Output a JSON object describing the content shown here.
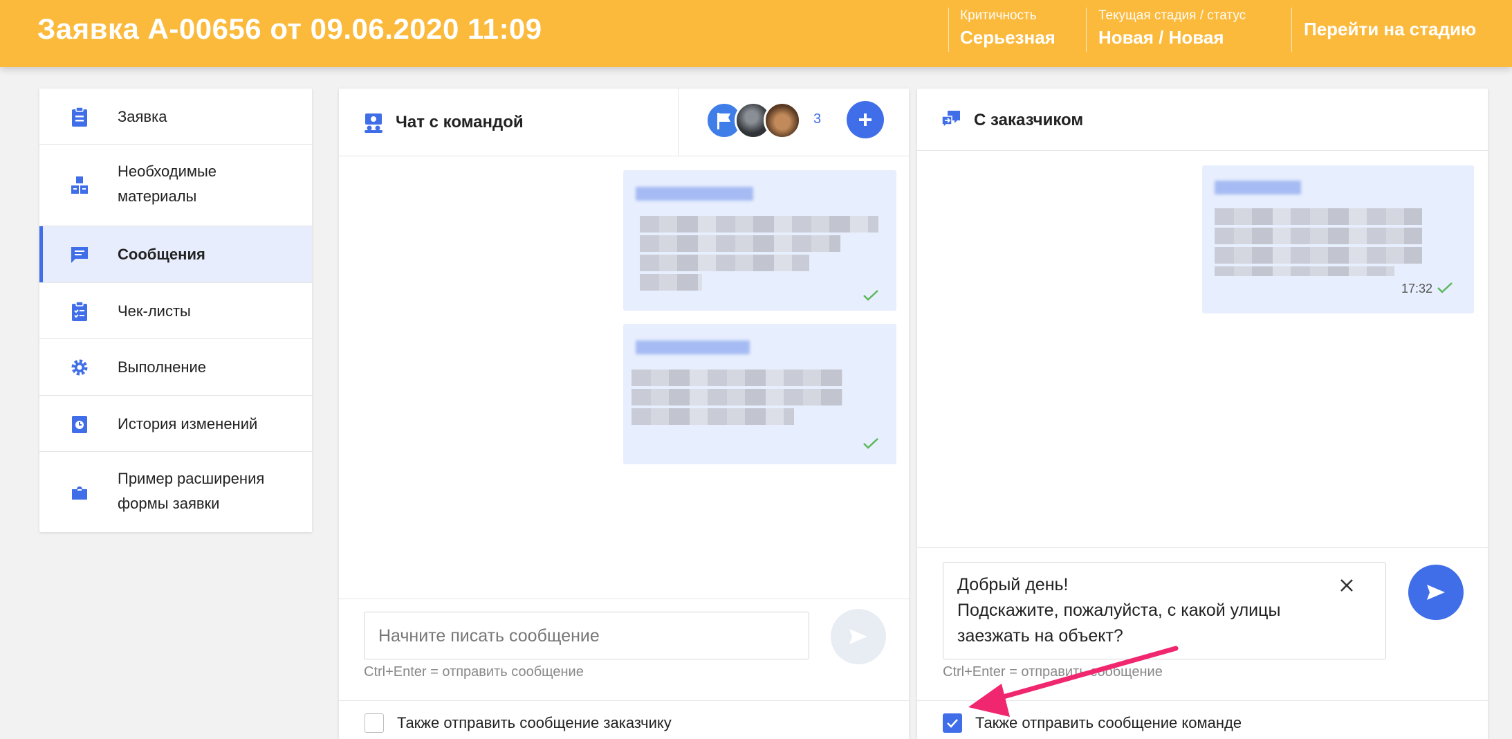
{
  "header": {
    "title": "Заявка А-00656 от 09.06.2020 11:09",
    "criticality_label": "Критичность",
    "criticality_value": "Серьезная",
    "stage_label": "Текущая стадия / статус",
    "stage_value": "Новая / Новая",
    "goto_stage": "Перейти на стадию"
  },
  "sidebar": {
    "items": [
      {
        "label": "Заявка",
        "icon": "clipboard-icon"
      },
      {
        "label_line1": "Необходимые",
        "label_line2": "материалы",
        "icon": "boxes-icon"
      },
      {
        "label": "Сообщения",
        "icon": "message-icon",
        "active": true
      },
      {
        "label": "Чек-листы",
        "icon": "checklist-icon"
      },
      {
        "label": "Выполнение",
        "icon": "gear-icon"
      },
      {
        "label": "История изменений",
        "icon": "history-icon"
      },
      {
        "label_line1": "Пример расширения",
        "label_line2": "формы заявки",
        "icon": "puzzle-icon"
      }
    ]
  },
  "team_chat": {
    "title": "Чат с командой",
    "participants_count": "3",
    "input_placeholder": "Начните писать сообщение",
    "hint": "Ctrl+Enter = отправить сообщение",
    "also_send_label": "Также отправить сообщение заказчику",
    "also_send_checked": false
  },
  "customer_chat": {
    "title": "С заказчиком",
    "message_time": "17:32",
    "input_line1": "Добрый день!",
    "input_line2": "Подскажите, пожалуйста, с какой улицы",
    "input_line3": "заезжать на объект?",
    "hint": "Ctrl+Enter = отправить сообщение",
    "also_send_label": "Также отправить сообщение команде",
    "also_send_checked": true
  },
  "colors": {
    "header": "#fbba3c",
    "accent": "#3f6ee8",
    "bubble": "#e7eefd",
    "check_green": "#5cb85c",
    "annotation_arrow": "#f0266e"
  }
}
